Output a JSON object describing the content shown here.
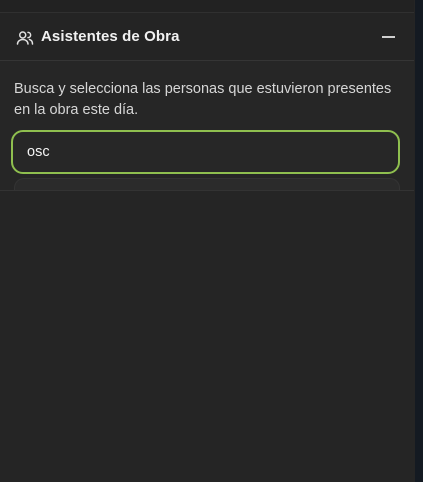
{
  "attendees_section": {
    "title": "Asistentes de Obra",
    "description": "Busca y selecciona las personas que estuvieron presentes en la obra este día.",
    "icon": "users-icon",
    "collapse_icon": "minus-icon",
    "search": {
      "value": "osc"
    }
  },
  "colors": {
    "accent": "#8fbf4f",
    "background": "#252525"
  }
}
